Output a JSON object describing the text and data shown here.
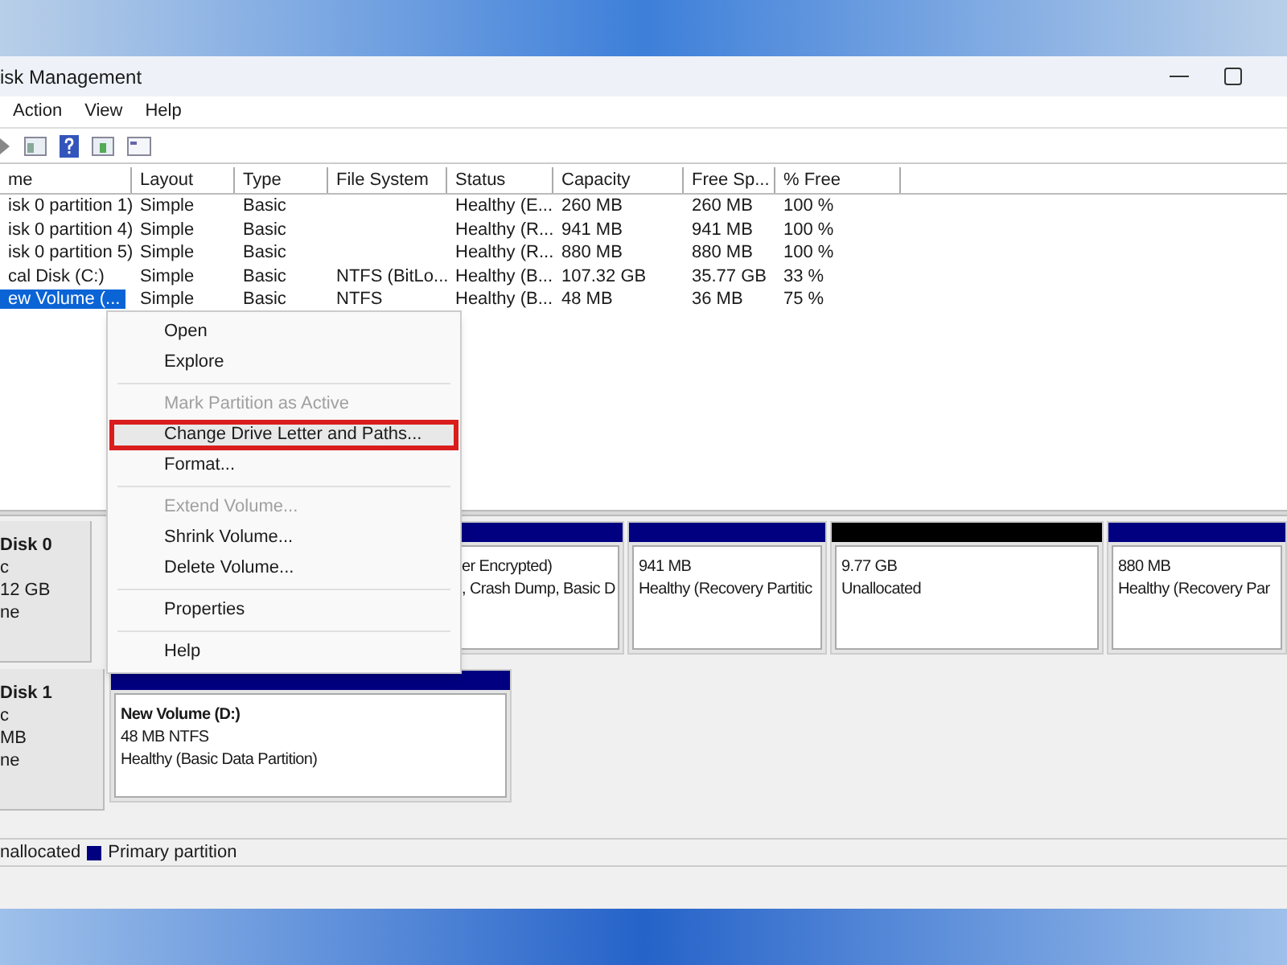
{
  "window": {
    "title": "isk Management"
  },
  "menu_bar": [
    "Action",
    "View",
    "Help"
  ],
  "table": {
    "columns": [
      "me",
      "Layout",
      "Type",
      "File System",
      "Status",
      "Capacity",
      "Free Sp...",
      "% Free"
    ],
    "rows": [
      {
        "cells": [
          "isk 0 partition 1)",
          "Simple",
          "Basic",
          "",
          "Healthy (E...",
          "260 MB",
          "260 MB",
          "100 %"
        ],
        "selected": false
      },
      {
        "cells": [
          "isk 0 partition 4)",
          "Simple",
          "Basic",
          "",
          "Healthy (R...",
          "941 MB",
          "941 MB",
          "100 %"
        ],
        "selected": false
      },
      {
        "cells": [
          "isk 0 partition 5)",
          "Simple",
          "Basic",
          "",
          "Healthy (R...",
          "880 MB",
          "880 MB",
          "100 %"
        ],
        "selected": false
      },
      {
        "cells": [
          "cal Disk (C:)",
          "Simple",
          "Basic",
          "NTFS (BitLo...",
          "Healthy (B...",
          "107.32 GB",
          "35.77 GB",
          "33 %"
        ],
        "selected": false
      },
      {
        "cells": [
          "ew Volume (...",
          "Simple",
          "Basic",
          "NTFS",
          "Healthy (B...",
          "48 MB",
          "36 MB",
          "75 %"
        ],
        "selected": true
      }
    ]
  },
  "context_menu": [
    {
      "kind": "item",
      "label": "Open",
      "disabled": false,
      "highlighted": false
    },
    {
      "kind": "item",
      "label": "Explore",
      "disabled": false,
      "highlighted": false
    },
    {
      "kind": "separator"
    },
    {
      "kind": "item",
      "label": "Mark Partition as Active",
      "disabled": true,
      "highlighted": false
    },
    {
      "kind": "item",
      "label": "Change Drive Letter and Paths...",
      "disabled": false,
      "highlighted": true
    },
    {
      "kind": "item",
      "label": "Format...",
      "disabled": false,
      "highlighted": false
    },
    {
      "kind": "separator"
    },
    {
      "kind": "item",
      "label": "Extend Volume...",
      "disabled": true,
      "highlighted": false
    },
    {
      "kind": "item",
      "label": "Shrink Volume...",
      "disabled": false,
      "highlighted": false
    },
    {
      "kind": "item",
      "label": "Delete Volume...",
      "disabled": false,
      "highlighted": false
    },
    {
      "kind": "separator"
    },
    {
      "kind": "item",
      "label": "Properties",
      "disabled": false,
      "highlighted": false
    },
    {
      "kind": "separator"
    },
    {
      "kind": "item",
      "label": "Help",
      "disabled": false,
      "highlighted": false
    }
  ],
  "disks": [
    {
      "name": "Disk 0",
      "lines": [
        "c",
        "12 GB",
        "ne"
      ],
      "partitions": [
        {
          "kind": "primary",
          "lines": [
            "er Encrypted)",
            ", Crash Dump, Basic D"
          ]
        },
        {
          "kind": "primary",
          "lines": [
            "941 MB",
            "Healthy (Recovery Partitic"
          ]
        },
        {
          "kind": "unallocated",
          "lines": [
            "9.77 GB",
            "Unallocated"
          ]
        },
        {
          "kind": "primary",
          "lines": [
            "880 MB",
            "Healthy (Recovery Par"
          ]
        }
      ]
    },
    {
      "name": "Disk 1",
      "lines": [
        "c",
        "MB",
        "ne"
      ],
      "partitions": [
        {
          "kind": "primary",
          "title": "New Volume  (D:)",
          "lines": [
            "48 MB NTFS",
            "Healthy (Basic Data Partition)"
          ]
        }
      ]
    }
  ],
  "legend": [
    {
      "label": "nallocated"
    },
    {
      "kind": "primary",
      "label": "Primary partition"
    }
  ]
}
